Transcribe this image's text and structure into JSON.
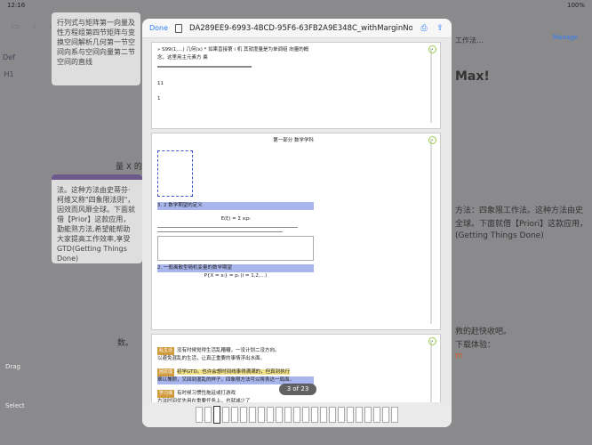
{
  "status": {
    "time": "12:16",
    "battery": "100%"
  },
  "modal": {
    "done_label": "Done",
    "title": "DA289EE9-6993-4BCD-95F6-63FB2A9E348C_withMarginNotes",
    "page_counter": "3 of 23"
  },
  "page1": {
    "header_text": "» S99(1,…) 几何(x) *  如果直接第 i 机  其就度量是为单调组 向量的概念，这里用主元素方 乘",
    "numbers": [
      "11",
      "1"
    ]
  },
  "page2": {
    "section_title": "第一部分  数学学科",
    "heading_mid": "E(ξ) = Σ xᵢpᵢ",
    "link1": "3. 2 数学期望的定义",
    "link2": "2. 一般离散型随机变量的数学期望",
    "formula": "P{X = xᵢ} = pᵢ (i = 1,2,…)"
  },
  "page3": {
    "tag1": "乱生活",
    "line1": "没有时候觉得生活乱糟糟，一没计划二没方向。",
    "line2": "以避免混乱的生活，让真正重要的事情浮出水面。",
    "tag2": "困扰理",
    "line3": "初学GTD。也许会想时间线事得满满的，但真到执行",
    "line4": "难以兼顾，又回到混乱的样子，四象限方法可以将表达一局面。",
    "tag3": "学习课",
    "line5": "有时候习惯性拖延或打游戏",
    "line6": "方法时间优先用在重要任务上，也就减少了"
  },
  "background": {
    "card1_text": "行列式与矩阵第一向量及性方程组第四节矩阵与变换空间解析几何第一节空间向系与空间向量第二节空间的直线",
    "card2_text": "法。这种方法由史蒂芬·柯维又称\"四象限法则\"，因效而风靡全球。下面就借【Prior】这款应用，勤能熟方法,希望能帮助大家提高工作效率,享受GTD(Getting Things Done)",
    "right_title": "工作法...",
    "right_manage": "Manage",
    "right_heading": "Max!",
    "right_p1": "方法：四象限工作法。这种方法由史",
    "right_p2": "全球。下面就借【Priori】这款应用，",
    "right_p3": "(Getting Things Done)",
    "right_p4": "救的赶快收吧。",
    "right_p5": "下载体验：",
    "right_link": "m",
    "left_rail": [
      "Def",
      "H1"
    ],
    "drag": "Drag",
    "select": "Select",
    "partial1": "量 X 的",
    "partial2": "数。"
  },
  "colors": {
    "accent": "#2f7cf6",
    "tag": "#d19b3d",
    "badge": "#9acb4e",
    "purple": "#6b5a8a"
  }
}
